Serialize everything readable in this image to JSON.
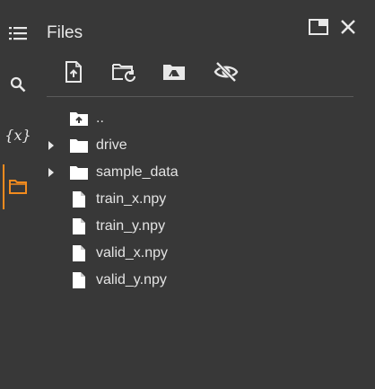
{
  "panel": {
    "title": "Files"
  },
  "rail": {
    "items": [
      {
        "name": "table-of-contents",
        "icon": "list-icon"
      },
      {
        "name": "search",
        "icon": "search-icon"
      },
      {
        "name": "variables",
        "icon": "variables-icon",
        "glyph": "{x}"
      },
      {
        "name": "files",
        "icon": "folder-icon",
        "active": true
      }
    ],
    "accent_color": "#f28b1e"
  },
  "header_actions": [
    {
      "name": "open-in-tab",
      "icon": "window-icon"
    },
    {
      "name": "close",
      "icon": "close-icon"
    }
  ],
  "toolbar": [
    {
      "name": "upload",
      "icon": "upload-file-icon"
    },
    {
      "name": "refresh",
      "icon": "folder-refresh-icon"
    },
    {
      "name": "mount-drive",
      "icon": "drive-folder-icon"
    },
    {
      "name": "toggle-hidden",
      "icon": "visibility-off-icon"
    }
  ],
  "tree": {
    "items": [
      {
        "label": "..",
        "type": "parent",
        "icon": "folder-up-icon",
        "expandable": false
      },
      {
        "label": "drive",
        "type": "folder",
        "icon": "folder-icon",
        "expandable": true
      },
      {
        "label": "sample_data",
        "type": "folder",
        "icon": "folder-icon",
        "expandable": true
      },
      {
        "label": "train_x.npy",
        "type": "file",
        "icon": "file-icon",
        "expandable": false
      },
      {
        "label": "train_y.npy",
        "type": "file",
        "icon": "file-icon",
        "expandable": false
      },
      {
        "label": "valid_x.npy",
        "type": "file",
        "icon": "file-icon",
        "expandable": false
      },
      {
        "label": "valid_y.npy",
        "type": "file",
        "icon": "file-icon",
        "expandable": false
      }
    ]
  }
}
